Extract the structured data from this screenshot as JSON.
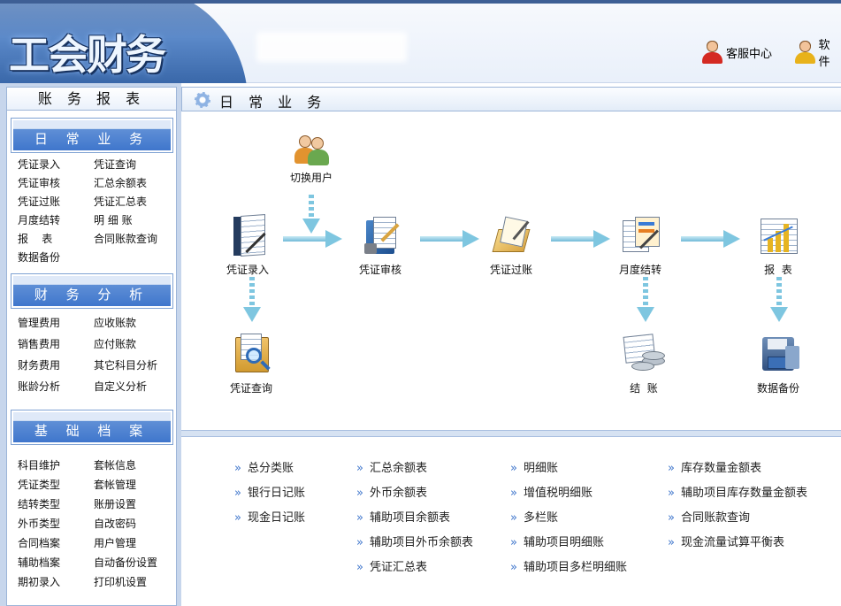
{
  "header": {
    "logo": "工会财务",
    "links": [
      {
        "label": "客服中心",
        "icon": "customer-service-icon"
      },
      {
        "label": "软件",
        "icon": "software-icon"
      }
    ]
  },
  "sidebar": {
    "title": "账 务 报 表",
    "sections": [
      {
        "title": "日 常 业 务",
        "items": [
          "凭证录入",
          "凭证查询",
          "凭证审核",
          "汇总余额表",
          "凭证过账",
          "凭证汇总表",
          "月度结转",
          "明 细 账",
          "报    表",
          "合同账款查询",
          "数据备份"
        ]
      },
      {
        "title": "财 务 分 析",
        "items": [
          "管理费用",
          "应收账款",
          "销售费用",
          "应付账款",
          "财务费用",
          "其它科目分析",
          "账龄分析",
          "自定义分析"
        ]
      },
      {
        "title": "基 础 档 案",
        "items": [
          "科目维护",
          "套帐信息",
          "凭证类型",
          "套帐管理",
          "结转类型",
          "账册设置",
          "外币类型",
          "自改密码",
          "合同档案",
          "用户管理",
          "辅助档案",
          "自动备份设置",
          "期初录入",
          "打印机设置"
        ]
      }
    ]
  },
  "main": {
    "title": "日 常 业 务",
    "flow": {
      "switch_user": "切换用户",
      "voucher_entry": "凭证录入",
      "voucher_audit": "凭证审核",
      "voucher_posting": "凭证过账",
      "month_end": "月度结转",
      "reports": "报  表",
      "voucher_query": "凭证查询",
      "close_books": "结  账",
      "data_backup": "数据备份"
    },
    "report_links": [
      [
        "总分类账",
        "银行日记账",
        "现金日记账"
      ],
      [
        "汇总余额表",
        "外币余额表",
        "辅助项目余额表",
        "辅助项目外币余额表",
        "凭证汇总表"
      ],
      [
        "明细账",
        "增值税明细账",
        "多栏账",
        "辅助项目明细账",
        "辅助项目多栏明细账"
      ],
      [
        "库存数量金额表",
        "辅助项目库存数量金额表",
        "合同账款查询",
        "现金流量试算平衡表"
      ]
    ]
  },
  "colors": {
    "accent": "#3f76cc",
    "header_band": "#3e5f95",
    "sidebar_bg": "#c7d6ec",
    "arrow": "#7ec6e0"
  }
}
